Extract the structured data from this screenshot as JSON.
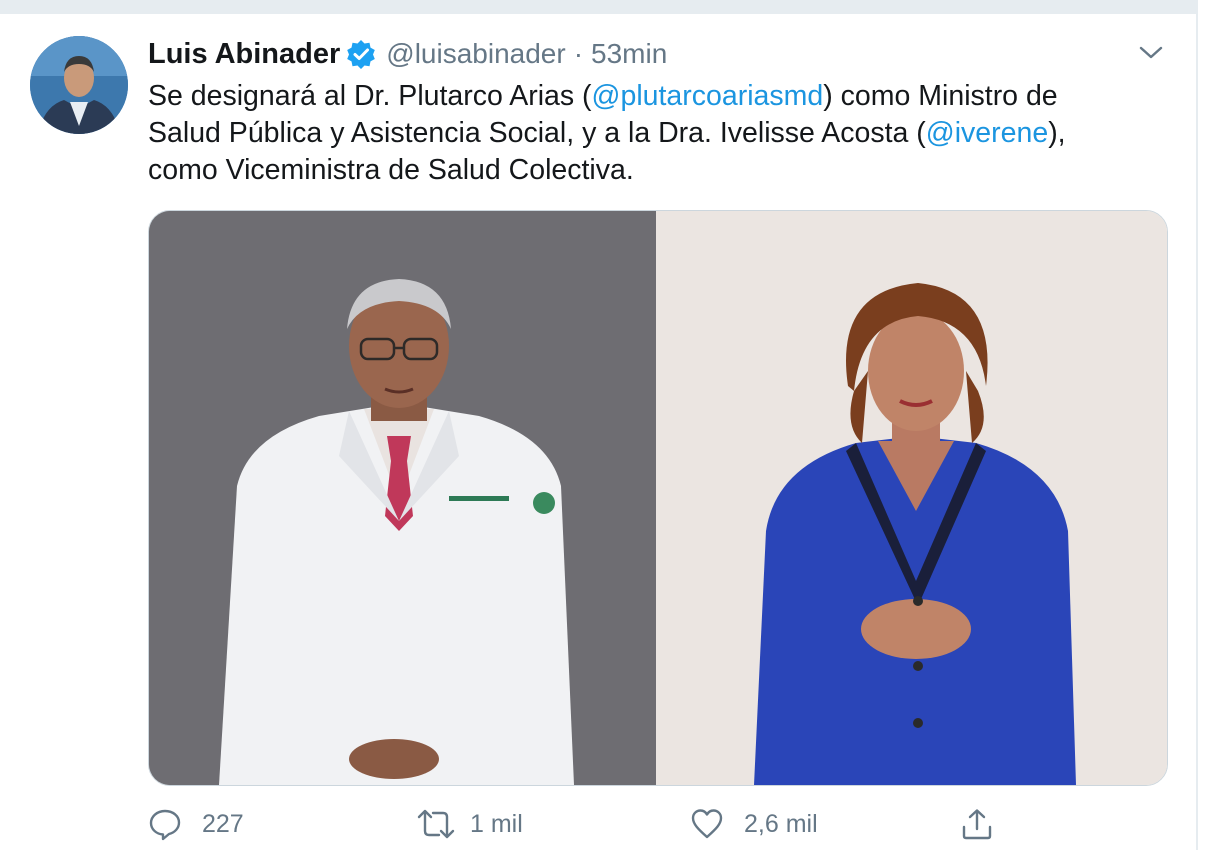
{
  "tweet": {
    "author_name": "Luis Abinader",
    "handle": "@luisabinader",
    "separator": "·",
    "time": "53min",
    "text_parts": [
      "Se designará al Dr. Plutarco Arias (",
      "@plutarcoariasmd",
      ") como Ministro de\nSalud Pública y Asistencia Social, y a la Dra. Ivelisse Acosta (",
      "@iverene",
      "),\ncomo Viceministra de Salud Colectiva."
    ],
    "media": [
      {
        "description": "man-in-white-lab-coat"
      },
      {
        "description": "woman-in-blue-jacket"
      }
    ],
    "actions": {
      "reply": {
        "icon": "reply-icon",
        "count": "227"
      },
      "retweet": {
        "icon": "retweet-icon",
        "count": "1 mil"
      },
      "like": {
        "icon": "heart-icon",
        "count": "2,6 mil"
      },
      "share": {
        "icon": "share-icon"
      }
    }
  },
  "colors": {
    "text": "#14171a",
    "secondary": "#657786",
    "accent": "#1b95e0",
    "verified": "#1da1f2",
    "divider": "#e6ecf0"
  }
}
